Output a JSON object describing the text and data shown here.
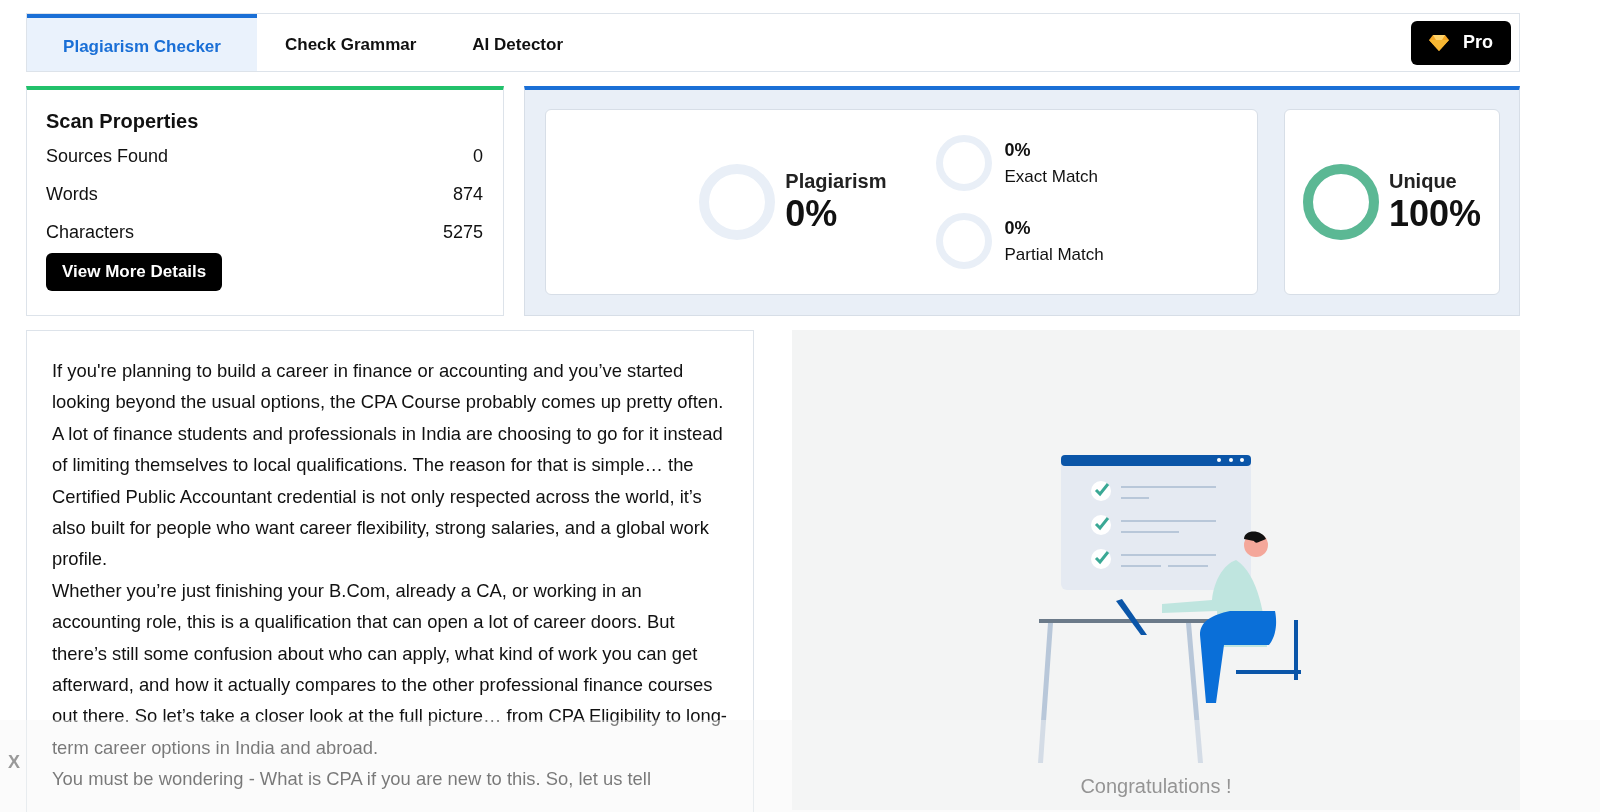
{
  "tabs": [
    {
      "label": "Plagiarism Checker",
      "selected": true
    },
    {
      "label": "Check Grammar",
      "selected": false
    },
    {
      "label": "AI Detector",
      "selected": false
    }
  ],
  "pro_button": {
    "label": "Pro"
  },
  "scan_properties": {
    "title": "Scan Properties",
    "rows": [
      {
        "label": "Sources Found",
        "value": "0"
      },
      {
        "label": "Words",
        "value": "874"
      },
      {
        "label": "Characters",
        "value": "5275"
      }
    ],
    "button": "View More Details"
  },
  "results": {
    "plagiarism": {
      "label": "Plagiarism",
      "value": "0%",
      "level": 0
    },
    "exact_match": {
      "label": "Exact Match",
      "value": "0%",
      "level": 0
    },
    "partial_match": {
      "label": "Partial Match",
      "value": "0%",
      "level": 0
    },
    "unique": {
      "label": "Unique",
      "value": "100%",
      "level": 1
    }
  },
  "document": {
    "paragraphs": [
      "If you're planning to build a career in finance or accounting and you’ve started looking beyond the usual options, the CPA Course probably comes up pretty often. A lot of finance students and professionals in India are choosing to go for it instead of limiting themselves to local qualifications. The reason for that is simple… the Certified Public Accountant credential is not only respected across the world, it’s also built for people who want career flexibility, strong salaries, and a global work profile.",
      "Whether you’re just finishing your B.Com, already a CA, or working in an accounting role, this is a qualification that can open a lot of career doors. But there’s still some confusion about who can apply, what kind of work you can get afterward, and how it actually compares to the other professional finance courses out there. So let’s take a closer look at the full picture… from CPA Eligibility to long-term career options in India and abroad.",
      " You must be wondering - What is CPA if you are new to this. So, let us tell"
    ]
  },
  "result_message": "Congratulations !",
  "overlay": {
    "close": "X"
  }
}
